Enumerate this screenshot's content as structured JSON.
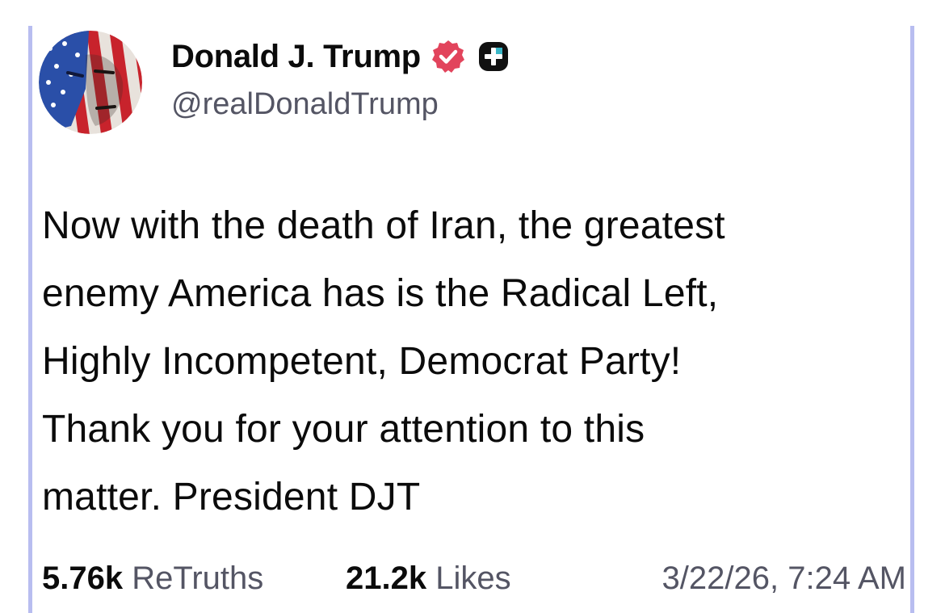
{
  "post": {
    "author": {
      "display_name": "Donald J. Trump",
      "handle": "@realDonaldTrump",
      "avatar_icon": "flag-portrait-avatar",
      "verified_icon": "verified-badge-icon",
      "verified_color": "#e2445c",
      "secondary_badge_icon": "plus-badge-icon"
    },
    "text_lines": [
      "Now with the death of Iran, the greatest",
      "enemy America has is the Radical Left,",
      "Highly Incompetent, Democrat Party!",
      "Thank you for your attention to this",
      "matter. President DJT"
    ],
    "stats": {
      "retruths_count": "5.76k",
      "retruths_label": "ReTruths",
      "likes_count": "21.2k",
      "likes_label": "Likes",
      "timestamp": "3/22/26, 7:24 AM"
    }
  },
  "colors": {
    "accent_rule": "#b8bdf0",
    "muted_text": "#545564",
    "primary_text": "#0b0b0b"
  }
}
